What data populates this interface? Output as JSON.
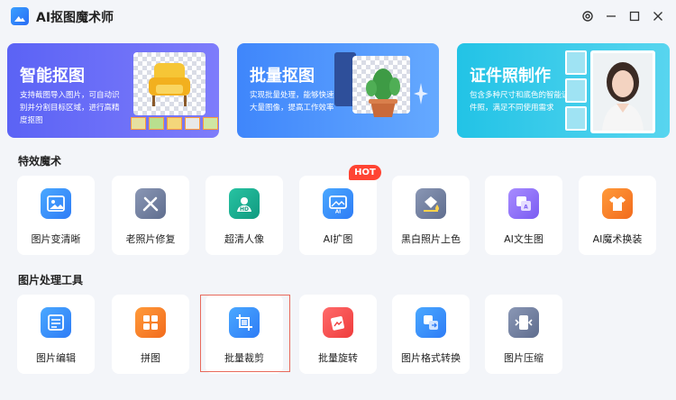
{
  "app": {
    "title": "AI抠图魔术师"
  },
  "banners": [
    {
      "title": "智能抠图",
      "desc": "支持截图导入图片，可自动识别并分割目标区域，进行高精度抠图"
    },
    {
      "title": "批量抠图",
      "desc": "实现批量处理，能够快速处理大量图像，提高工作效率"
    },
    {
      "title": "证件照制作",
      "desc": "包含多种尺寸和底色的智能证件照，满足不同使用需求"
    }
  ],
  "sections": {
    "effects": "特效魔术",
    "tools": "图片处理工具"
  },
  "effects": [
    {
      "label": "图片变清晰"
    },
    {
      "label": "老照片修复"
    },
    {
      "label": "超清人像"
    },
    {
      "label": "AI扩图",
      "badge": "HOT"
    },
    {
      "label": "黑白照片上色"
    },
    {
      "label": "AI文生图"
    },
    {
      "label": "AI魔术换装"
    }
  ],
  "tools": [
    {
      "label": "图片编辑"
    },
    {
      "label": "拼图"
    },
    {
      "label": "批量裁剪"
    },
    {
      "label": "批量旋转"
    },
    {
      "label": "图片格式转换"
    },
    {
      "label": "图片压缩"
    }
  ],
  "selected_tool": "批量裁剪",
  "colors": {
    "accent": "#3f86fb",
    "hot": "#ff4433",
    "selection": "#e86a5c"
  }
}
